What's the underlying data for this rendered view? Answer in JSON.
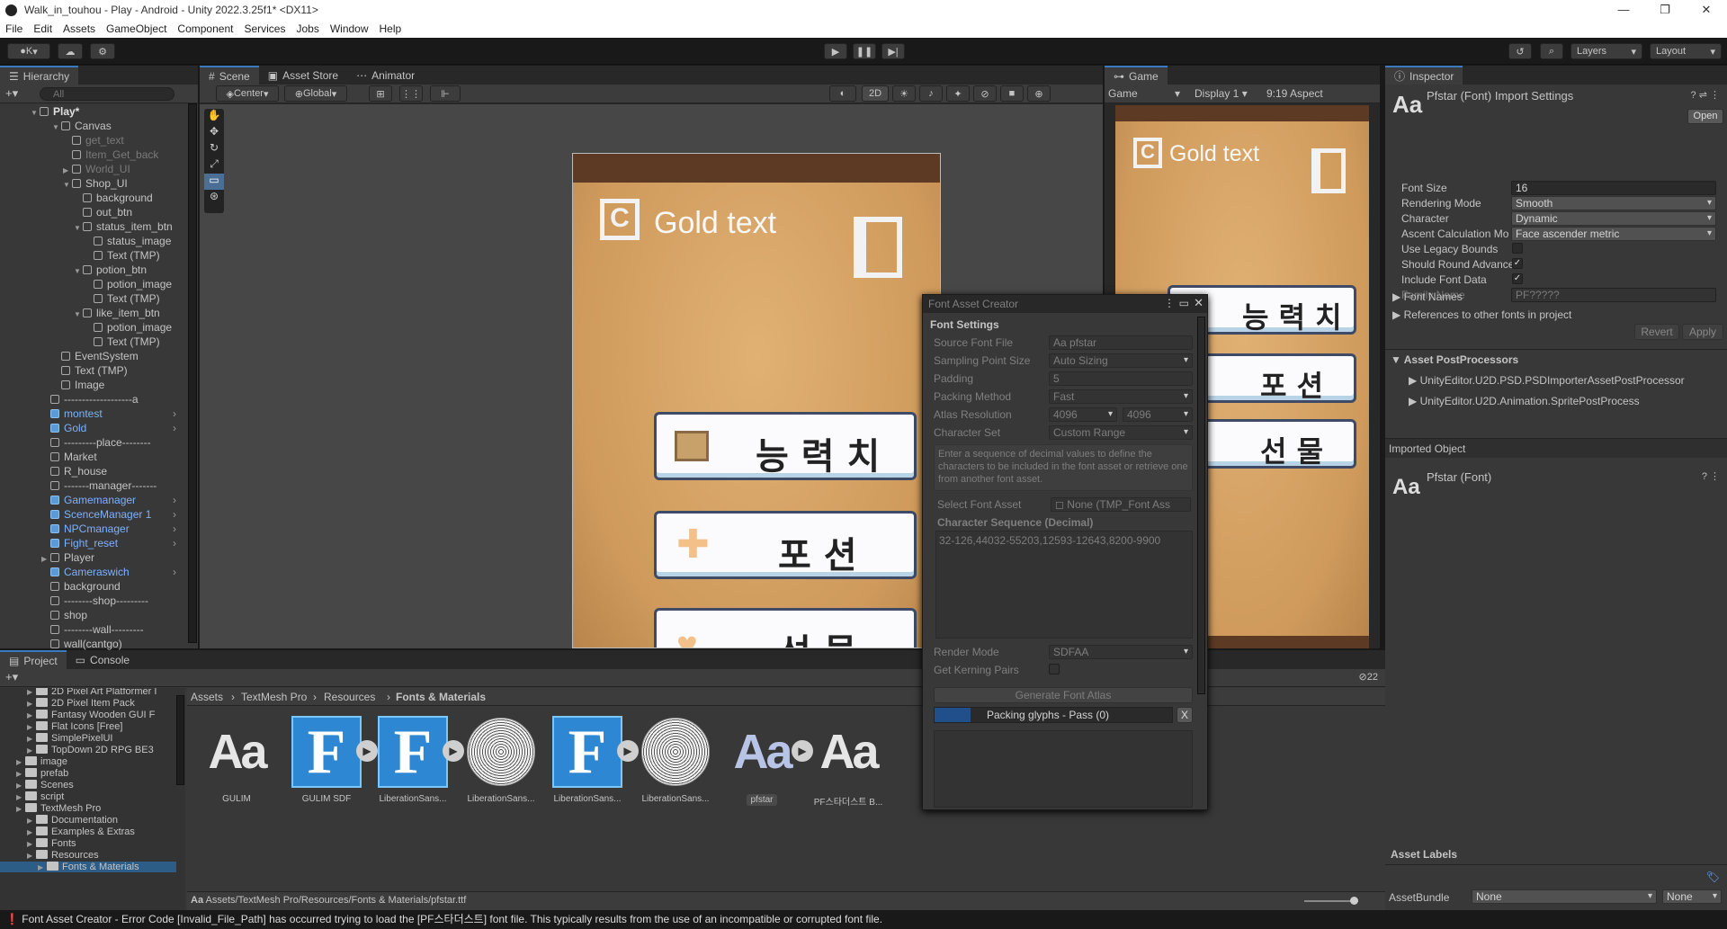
{
  "window": {
    "title": "Walk_in_touhou - Play - Android - Unity 2022.3.25f1* <DX11>",
    "controls": [
      "—",
      "❐",
      "✕"
    ]
  },
  "menu": [
    "File",
    "Edit",
    "Assets",
    "GameObject",
    "Component",
    "Services",
    "Jobs",
    "Window",
    "Help"
  ],
  "toolbar": {
    "account": "K",
    "layers": "Layers",
    "layout": "Layout"
  },
  "hierarchy": {
    "tab": "Hierarchy",
    "search_placeholder": "All",
    "root": "Play*",
    "items": [
      {
        "label": "Canvas",
        "indent": 2,
        "style": "normal",
        "arrow": "▼"
      },
      {
        "label": "get_text",
        "indent": 3,
        "style": "dim",
        "arrow": ""
      },
      {
        "label": "Item_Get_back",
        "indent": 3,
        "style": "dim",
        "arrow": ""
      },
      {
        "label": "World_UI",
        "indent": 3,
        "style": "dim",
        "arrow": "▶"
      },
      {
        "label": "Shop_UI",
        "indent": 3,
        "style": "normal",
        "arrow": "▼"
      },
      {
        "label": "background",
        "indent": 4,
        "style": "normal",
        "arrow": ""
      },
      {
        "label": "out_btn",
        "indent": 4,
        "style": "normal",
        "arrow": ""
      },
      {
        "label": "status_item_btn",
        "indent": 4,
        "style": "normal",
        "arrow": "▼"
      },
      {
        "label": "status_image",
        "indent": 5,
        "style": "normal",
        "arrow": ""
      },
      {
        "label": "Text (TMP)",
        "indent": 5,
        "style": "normal",
        "arrow": ""
      },
      {
        "label": "potion_btn",
        "indent": 4,
        "style": "normal",
        "arrow": "▼"
      },
      {
        "label": "potion_image",
        "indent": 5,
        "style": "normal",
        "arrow": ""
      },
      {
        "label": "Text (TMP)",
        "indent": 5,
        "style": "normal",
        "arrow": ""
      },
      {
        "label": "like_item_btn",
        "indent": 4,
        "style": "normal",
        "arrow": "▼"
      },
      {
        "label": "potion_image",
        "indent": 5,
        "style": "normal",
        "arrow": ""
      },
      {
        "label": "Text (TMP)",
        "indent": 5,
        "style": "normal",
        "arrow": ""
      },
      {
        "label": "EventSystem",
        "indent": 2,
        "style": "normal",
        "arrow": ""
      },
      {
        "label": "Text (TMP)",
        "indent": 2,
        "style": "normal",
        "arrow": ""
      },
      {
        "label": "Image",
        "indent": 2,
        "style": "normal",
        "arrow": ""
      },
      {
        "label": "-------------------a",
        "indent": 1,
        "style": "normal",
        "arrow": ""
      },
      {
        "label": "montest",
        "indent": 1,
        "style": "blue",
        "arrow": ""
      },
      {
        "label": "Gold",
        "indent": 1,
        "style": "blue",
        "arrow": ""
      },
      {
        "label": "---------place--------",
        "indent": 1,
        "style": "normal",
        "arrow": ""
      },
      {
        "label": "Market",
        "indent": 1,
        "style": "normal",
        "arrow": ""
      },
      {
        "label": "R_house",
        "indent": 1,
        "style": "normal",
        "arrow": ""
      },
      {
        "label": "-------manager-------",
        "indent": 1,
        "style": "normal",
        "arrow": ""
      },
      {
        "label": "Gamemanager",
        "indent": 1,
        "style": "blue",
        "arrow": ""
      },
      {
        "label": "ScenceManager 1",
        "indent": 1,
        "style": "blue",
        "arrow": ""
      },
      {
        "label": "NPCmanager",
        "indent": 1,
        "style": "blue",
        "arrow": ""
      },
      {
        "label": "Fight_reset",
        "indent": 1,
        "style": "blue",
        "arrow": ""
      },
      {
        "label": "Player",
        "indent": 1,
        "style": "normal",
        "arrow": "▶"
      },
      {
        "label": "Cameraswich",
        "indent": 1,
        "style": "blue",
        "arrow": ""
      },
      {
        "label": "background",
        "indent": 1,
        "style": "normal",
        "arrow": ""
      },
      {
        "label": "--------shop---------",
        "indent": 1,
        "style": "normal",
        "arrow": ""
      },
      {
        "label": "shop",
        "indent": 1,
        "style": "normal",
        "arrow": ""
      },
      {
        "label": "--------wall---------",
        "indent": 1,
        "style": "normal",
        "arrow": ""
      },
      {
        "label": "wall(cantgo)",
        "indent": 1,
        "style": "normal",
        "arrow": ""
      }
    ]
  },
  "scene_tabs": [
    "Scene",
    "Asset Store",
    "Animator"
  ],
  "scene_toolbar": {
    "pivot": "Center",
    "space": "Global",
    "mode_2d": "2D"
  },
  "shop_ui": {
    "gold_text": "Gold text",
    "buttons": [
      "능력치",
      "포션",
      "선물"
    ],
    "button_spaced": [
      "능 력 치",
      "포 션",
      "선 물"
    ]
  },
  "game": {
    "tab": "Game",
    "mode": "Game",
    "display": "Display 1",
    "aspect": "9:19 Aspect"
  },
  "font_asset_creator": {
    "title": "Font Asset Creator",
    "section": "Font Settings",
    "source_font_label": "Source Font File",
    "source_font_value": "pfstar",
    "sampling_label": "Sampling Point Size",
    "sampling_value": "Auto Sizing",
    "padding_label": "Padding",
    "padding_value": "5",
    "packing_label": "Packing Method",
    "packing_value": "Fast",
    "atlas_label": "Atlas Resolution",
    "atlas_w": "4096",
    "atlas_h": "4096",
    "charset_label": "Character Set",
    "charset_value": "Custom Range",
    "help": "Enter a sequence of decimal values to define the characters to be included in the font asset or retrieve one from another font asset.",
    "select_font_label": "Select Font Asset",
    "select_font_value": "None (TMP_Font Ass",
    "sequence_label": "Character Sequence (Decimal)",
    "sequence_value": "32-126,44032-55203,12593-12643,8200-9900",
    "render_label": "Render Mode",
    "render_value": "SDFAA",
    "kerning_label": "Get Kerning Pairs",
    "generate": "Generate Font Atlas",
    "progress_label": "Packing glyphs - Pass (0)",
    "progress_fraction": 0.15
  },
  "inspector": {
    "tab": "Inspector",
    "title": "Pfstar (Font) Import Settings",
    "open": "Open",
    "rows": [
      {
        "label": "Font Size",
        "type": "text",
        "value": "16"
      },
      {
        "label": "Rendering Mode",
        "type": "drop",
        "value": "Smooth"
      },
      {
        "label": "Character",
        "type": "drop",
        "value": "Dynamic"
      },
      {
        "label": "Ascent Calculation Mo",
        "type": "drop",
        "value": "Face ascender metric"
      },
      {
        "label": "Use Legacy Bounds",
        "type": "check",
        "value": ""
      },
      {
        "label": "Should Round Advance",
        "type": "check",
        "value": "✓"
      },
      {
        "label": "Include Font Data",
        "type": "check",
        "value": "✓"
      },
      {
        "label": "Family Name",
        "type": "textdim",
        "value": "PF?????"
      }
    ],
    "font_names": "Font Names",
    "references": "References to other fonts in project",
    "revert": "Revert",
    "apply": "Apply",
    "postprocessors_header": "Asset PostProcessors",
    "postprocessors": [
      "UnityEditor.U2D.PSD.PSDImporterAssetPostProcessor",
      "UnityEditor.U2D.Animation.SpritePostProcess"
    ],
    "imported_object": "Imported Object",
    "imported_name": "Pfstar (Font)",
    "asset_labels": "Asset Labels",
    "asset_bundle_label": "AssetBundle",
    "asset_bundle_value": "None",
    "asset_bundle_variant": "None"
  },
  "project": {
    "tabs": [
      "Project",
      "Console"
    ],
    "tree": [
      {
        "label": "2D Pixel Art Platformer I",
        "indent": 1
      },
      {
        "label": "2D Pixel Item Pack",
        "indent": 1
      },
      {
        "label": "Fantasy Wooden GUI  F",
        "indent": 1
      },
      {
        "label": "Flat Icons [Free]",
        "indent": 1
      },
      {
        "label": "SimplePixelUI",
        "indent": 1
      },
      {
        "label": "TopDown 2D RPG BE3",
        "indent": 1
      },
      {
        "label": "image",
        "indent": 0
      },
      {
        "label": "prefab",
        "indent": 0
      },
      {
        "label": "Scenes",
        "indent": 0
      },
      {
        "label": "script",
        "indent": 0
      },
      {
        "label": "TextMesh Pro",
        "indent": 0
      },
      {
        "label": "Documentation",
        "indent": 1
      },
      {
        "label": "Examples & Extras",
        "indent": 1
      },
      {
        "label": "Fonts",
        "indent": 1
      },
      {
        "label": "Resources",
        "indent": 1
      },
      {
        "label": "Fonts & Materials",
        "indent": 2
      }
    ],
    "breadcrumb": [
      "Assets",
      "TextMesh Pro",
      "Resources",
      "Fonts & Materials"
    ],
    "assets": [
      {
        "name": "GULIM",
        "kind": "aa"
      },
      {
        "name": "GULIM SDF",
        "kind": "f"
      },
      {
        "name": "LiberationSans...",
        "kind": "f"
      },
      {
        "name": "LiberationSans...",
        "kind": "circ"
      },
      {
        "name": "LiberationSans...",
        "kind": "f"
      },
      {
        "name": "LiberationSans...",
        "kind": "circ"
      },
      {
        "name": "pfstar",
        "kind": "aa2"
      },
      {
        "name": "PF스타더스트 B...",
        "kind": "aa"
      }
    ],
    "path": "Assets/TextMesh Pro/Resources/Fonts & Materials/pfstar.ttf",
    "hidden_count": "22"
  },
  "status": "Font Asset Creator - Error Code [Invalid_File_Path] has occurred trying to load the [PF스타더스트] font file. This typically results from the use of an incompatible or corrupted font file."
}
